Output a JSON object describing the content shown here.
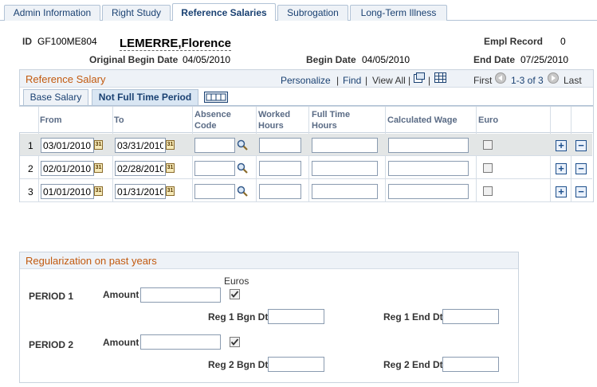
{
  "tabs": [
    {
      "label": "Admin Information",
      "active": false
    },
    {
      "label": "Right Study",
      "active": false
    },
    {
      "label": "Reference Salaries",
      "active": true
    },
    {
      "label": "Subrogation",
      "active": false
    },
    {
      "label": "Long-Term Illness",
      "active": false
    }
  ],
  "header": {
    "id_label": "ID",
    "id_value": "GF100ME804",
    "name": "LEMERRE,Florence",
    "empl_record_label": "Empl Record",
    "empl_record_value": "0",
    "orig_begin_label": "Original Begin Date",
    "orig_begin_value": "04/05/2010",
    "begin_label": "Begin Date",
    "begin_value": "04/05/2010",
    "end_label": "End Date",
    "end_value": "07/25/2010"
  },
  "ref_salary": {
    "title": "Reference Salary",
    "personalize": "Personalize",
    "separator": "|",
    "find": "Find",
    "view_all": "View All",
    "first": "First",
    "range": "1-3 of 3",
    "last": "Last",
    "subtabs": [
      "Base Salary",
      "Not Full Time Period"
    ],
    "columns": {
      "from": "From",
      "to": "To",
      "absence_code_1": "Absence",
      "absence_code_2": "Code",
      "worked_hours_1": "Worked",
      "worked_hours_2": "Hours",
      "full_time_hours_1": "Full Time",
      "full_time_hours_2": "Hours",
      "calculated_wage": "Calculated Wage",
      "euro": "Euro"
    },
    "rows": [
      {
        "num": "1",
        "from": "03/01/2010",
        "to": "03/31/2010",
        "absence_code": "",
        "worked_hours": "",
        "full_time_hours": "",
        "calculated_wage": "",
        "euro": false
      },
      {
        "num": "2",
        "from": "02/01/2010",
        "to": "02/28/2010",
        "absence_code": "",
        "worked_hours": "",
        "full_time_hours": "",
        "calculated_wage": "",
        "euro": false
      },
      {
        "num": "3",
        "from": "01/01/2010",
        "to": "01/31/2010",
        "absence_code": "",
        "worked_hours": "",
        "full_time_hours": "",
        "calculated_wage": "",
        "euro": false
      }
    ]
  },
  "regularization": {
    "title": "Regularization on past years",
    "euros_label": "Euros",
    "amount_label": "Amount",
    "period1": {
      "label": "PERIOD 1",
      "amount": "",
      "euros_checked": true,
      "bgn_label": "Reg 1 Bgn Dt",
      "bgn_value": "",
      "end_label": "Reg 1 End Dt",
      "end_value": ""
    },
    "period2": {
      "label": "PERIOD 2",
      "amount": "",
      "euros_checked": true,
      "bgn_label": "Reg 2 Bgn Dt",
      "bgn_value": "",
      "end_label": "Reg 2 End Dt",
      "end_value": ""
    }
  },
  "icons": {
    "calendar": "calendar-icon",
    "lookup": "magnifier-icon",
    "add": "plus-icon",
    "delete": "minus-icon",
    "zoom": "new-window-icon",
    "download": "grid-icon",
    "first": "left-arrow-icon",
    "last": "right-arrow-icon",
    "show_all_columns": "show-all-columns-icon"
  },
  "colors": {
    "section_title": "#c25a0f",
    "link": "#1a4172",
    "selected_row": "#e3e6e6"
  }
}
